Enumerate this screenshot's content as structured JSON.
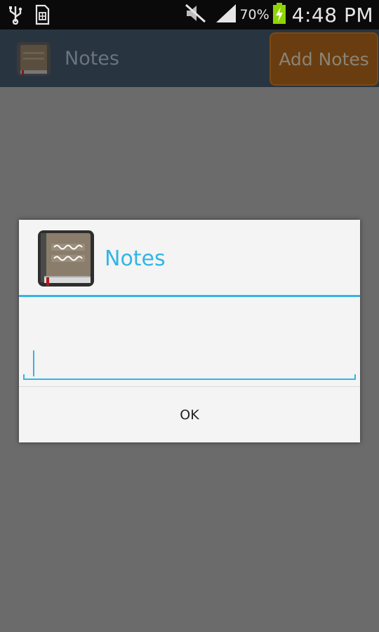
{
  "status_bar": {
    "icons": [
      "usb-icon",
      "sim-icon",
      "mute-icon",
      "signal-icon",
      "battery-charging-icon"
    ],
    "battery_percent": "70%",
    "time": "4:48 PM"
  },
  "action_bar": {
    "title": "Notes",
    "add_button_label": "Add Notes"
  },
  "dialog": {
    "title": "Notes",
    "input_value": "",
    "ok_label": "OK"
  },
  "colors": {
    "accent": "#33b5e5",
    "action_bar": "#293441",
    "add_button": "#6a3d10",
    "dialog_bg": "#f4f4f4",
    "overlay": "#6b6b6b"
  }
}
